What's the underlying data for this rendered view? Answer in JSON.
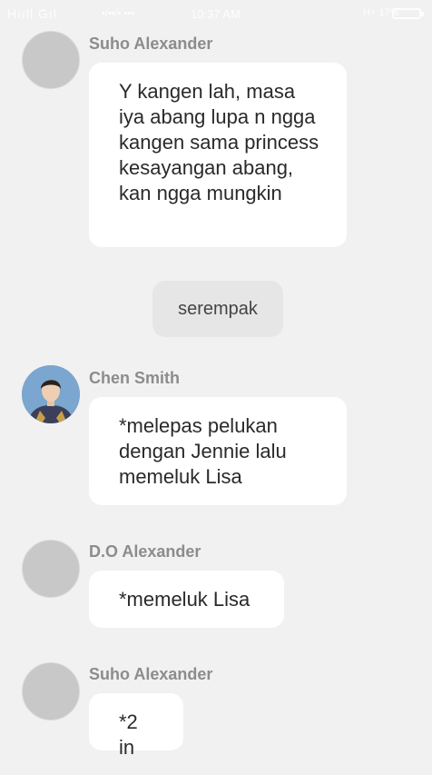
{
  "status_bar": {
    "signal": "Hııll Gıl",
    "info": "•/••/• •••",
    "time": "10:37 AM",
    "indicators": "H+ 17%"
  },
  "messages": [
    {
      "sender": "Suho Alexander",
      "text": "Y kangen lah, masa iya abang lupa n ngga kangen sama princess kesayangan abang, kan ngga mungkin"
    },
    {
      "system": "serempak"
    },
    {
      "sender": "Chen Smith",
      "text": "*melepas pelukan dengan Jennie lalu memeluk Lisa"
    },
    {
      "sender": "D.O Alexander",
      "text": "*memeluk Lisa"
    },
    {
      "sender": "Suho Alexander",
      "text": "*2 in"
    }
  ]
}
